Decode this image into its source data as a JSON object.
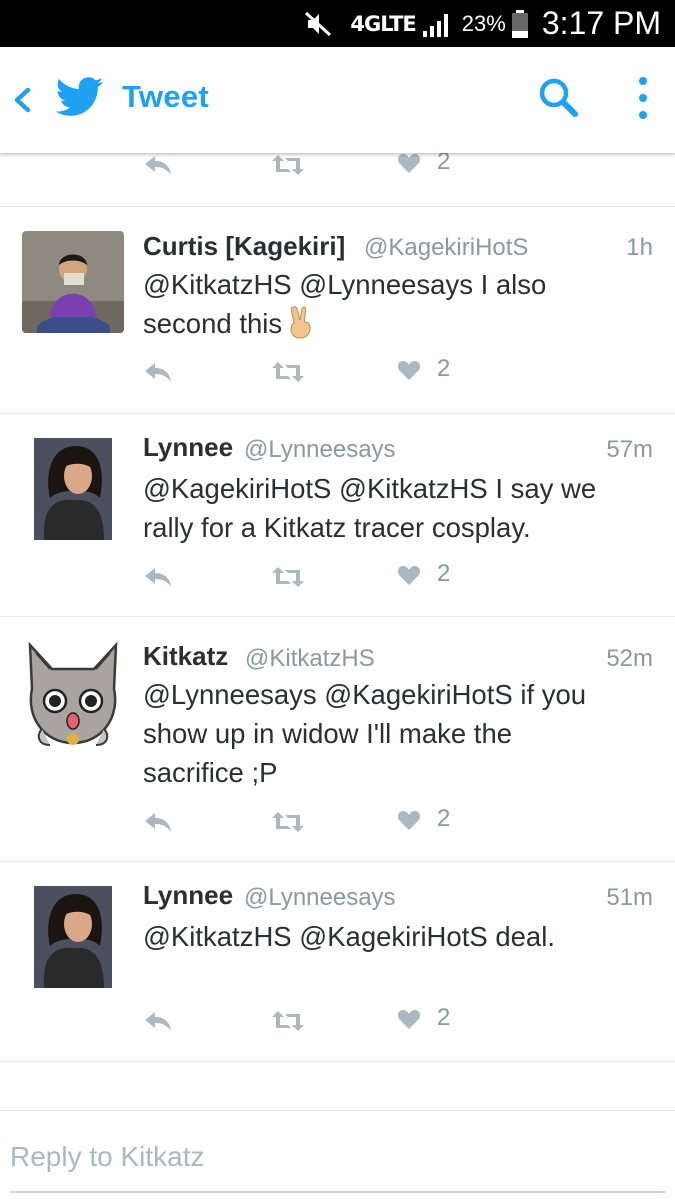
{
  "status_bar": {
    "network": "4GLTE",
    "battery_percent": "23%",
    "time": "3:17 PM",
    "icons": [
      "mute-icon",
      "signal-icon",
      "battery-icon"
    ]
  },
  "header": {
    "title": "Tweet",
    "icons": [
      "back-icon",
      "twitter-bird-icon",
      "search-icon",
      "more-icon"
    ],
    "accent_color": "#1da1f2"
  },
  "top_actions": {
    "likes": "2"
  },
  "tweets": [
    {
      "name": "Curtis [Kagekiri]",
      "handle": "@KagekiriHotS",
      "time": "1h",
      "text_lines": [
        "@KitkatzHS @Lynneesays I also",
        "second this"
      ],
      "emoji": "victory-hand-emoji",
      "likes": "2"
    },
    {
      "name": "Lynnee",
      "handle": "@Lynneesays",
      "time": "57m",
      "text_lines": [
        "@KagekiriHotS @KitkatzHS I say we",
        "rally for a Kitkatz tracer cosplay."
      ],
      "likes": "2"
    },
    {
      "name": "Kitkatz",
      "handle": "@KitkatzHS",
      "time": "52m",
      "text_lines": [
        "@Lynneesays @KagekiriHotS if you",
        "show up in widow I'll make the",
        "sacrifice ;P"
      ],
      "likes": "2"
    },
    {
      "name": "Lynnee",
      "handle": "@Lynneesays",
      "time": "51m",
      "text_lines": [
        "@KitkatzHS @KagekiriHotS deal."
      ],
      "likes": "2"
    }
  ],
  "reply": {
    "placeholder": "Reply to Kitkatz"
  },
  "colors": {
    "text": "#292f33",
    "secondary": "#8899a6",
    "divider": "#e1e8ed",
    "twitter_blue": "#1da1f2"
  }
}
